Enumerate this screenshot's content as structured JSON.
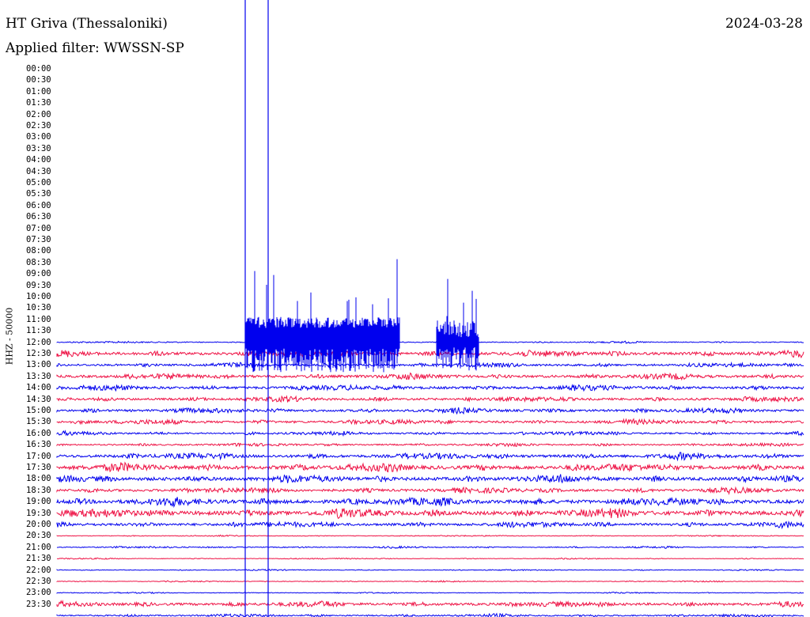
{
  "header": {
    "station": "HT Griva (Thessaloniki)",
    "date": "2024-03-28",
    "filter": "Applied filter: WWSSN-SP"
  },
  "chart_data": {
    "type": "line",
    "ylabel": "HHZ - 50000",
    "time_labels": [
      "00:00",
      "00:30",
      "01:00",
      "01:30",
      "02:00",
      "02:30",
      "03:00",
      "03:30",
      "04:00",
      "04:30",
      "05:00",
      "05:30",
      "06:00",
      "06:30",
      "07:00",
      "07:30",
      "08:00",
      "08:30",
      "09:00",
      "09:30",
      "10:00",
      "10:30",
      "11:00",
      "11:30",
      "12:00",
      "12:30",
      "13:00",
      "13:30",
      "14:00",
      "14:30",
      "15:00",
      "15:30",
      "16:00",
      "16:30",
      "17:00",
      "17:30",
      "18:00",
      "18:30",
      "19:00",
      "19:30",
      "20:00",
      "20:30",
      "21:00",
      "21:30",
      "22:00",
      "22:30",
      "23:00",
      "23:30"
    ],
    "trace_colors": [
      "#0000ee",
      "#ee1144"
    ],
    "trace_start": "12:00",
    "relative_amplitude": [
      0.3,
      1.0,
      0.7,
      0.9,
      0.9,
      0.8,
      0.8,
      0.8,
      0.6,
      0.5,
      1.0,
      1.3,
      1.2,
      0.9,
      1.3,
      1.4,
      0.9,
      0.2,
      0.3,
      0.2,
      0.2,
      0.2,
      0.2,
      0.9,
      0.5,
      0.2
    ],
    "markers": [
      {
        "time": "11:00",
        "minute_offset": 8.8
      },
      {
        "time": "11:00",
        "minute_offset": 9.7
      }
    ]
  }
}
